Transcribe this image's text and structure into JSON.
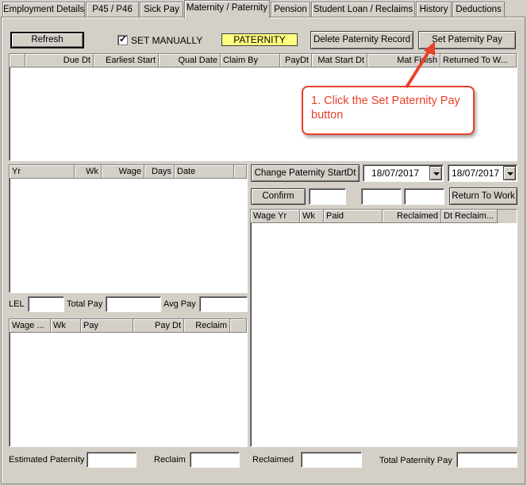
{
  "tabs": [
    {
      "label": "Employment Details"
    },
    {
      "label": "P45 / P46"
    },
    {
      "label": "Sick Pay"
    },
    {
      "label": "Maternity / Paternity"
    },
    {
      "label": "Pension"
    },
    {
      "label": "Student Loan / Reclaims"
    },
    {
      "label": "History"
    },
    {
      "label": "Deductions"
    }
  ],
  "active_tab": "Maternity / Paternity",
  "toolbar": {
    "refresh_label": "Refresh",
    "set_manually_label": "SET MANUALLY",
    "set_manually_checked": true,
    "paternity_badge": "PATERNITY",
    "delete_label": "Delete Paternity Record",
    "set_pay_label": "Set Paternity Pay"
  },
  "main_list": {
    "columns": [
      "Due Dt",
      "Earliest Start",
      "Qual Date",
      "Claim By",
      "PayDt",
      "Mat Start Dt",
      "Mat Finish",
      "Returned To W..."
    ]
  },
  "callout": {
    "text": "1. Click the Set Paternity Pay button",
    "color": "#e8402a"
  },
  "wage_list": {
    "columns": [
      "Yr",
      "Wk",
      "Wage",
      "Days",
      "Date"
    ]
  },
  "dates": {
    "change_label": "Change Paternity StartDt",
    "start_date": "18/07/2017",
    "end_date": "18/07/2017",
    "confirm_label": "Confirm",
    "return_label": "Return To Work"
  },
  "summary_row": {
    "lel_label": "LEL",
    "total_pay_label": "Total Pay",
    "avg_pay_label": "Avg Pay"
  },
  "pay_list": {
    "columns": [
      "Wage ...",
      "Wk",
      "Pay",
      "Pay Dt",
      "Reclaim"
    ]
  },
  "reclaim_list": {
    "columns": [
      "Wage Yr",
      "Wk",
      "Paid",
      "Reclaimed",
      "Dt Reclaim..."
    ]
  },
  "footer": {
    "estimated_label": "Estimated Paternity",
    "reclaim_label": "Reclaim",
    "reclaimed_label": "Reclaimed",
    "total_label": "Total Paternity Pay"
  },
  "colors": {
    "badge_bg": "#ffff80",
    "panel_bg": "#d4d0c8"
  }
}
